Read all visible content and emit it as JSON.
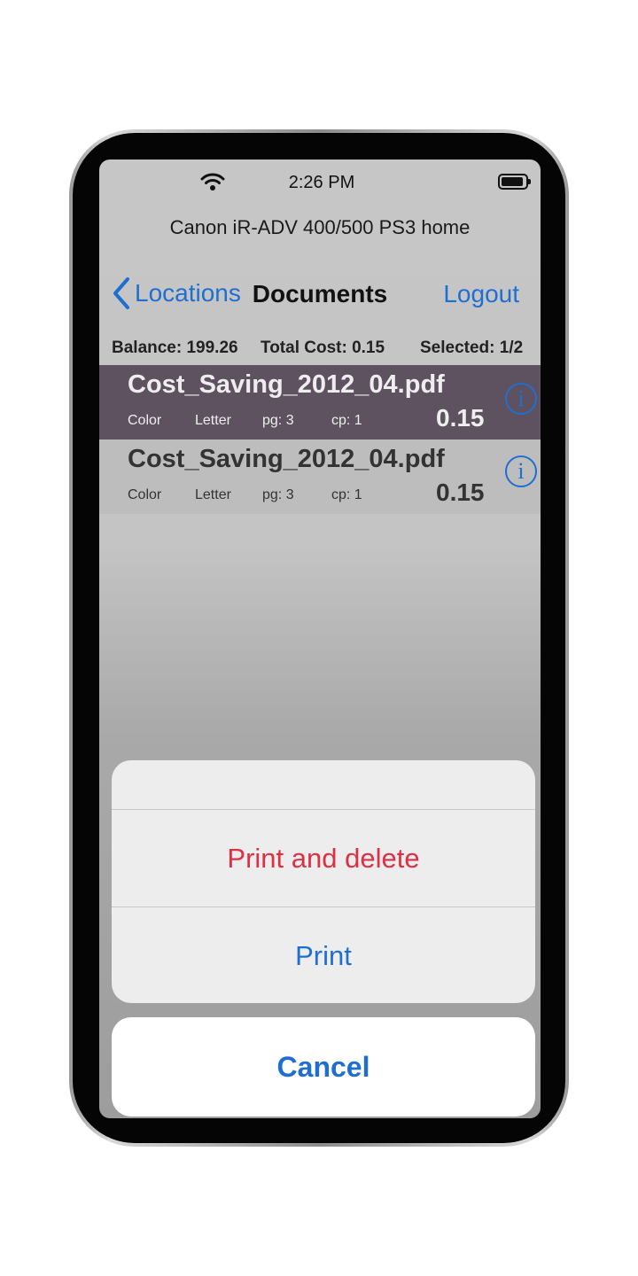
{
  "status_bar": {
    "time": "2:26 PM",
    "wifi_icon": "wifi-icon",
    "battery_icon": "battery-icon"
  },
  "printer_name": "Canon iR-ADV 400/500 PS3 home",
  "nav": {
    "back_label": "Locations",
    "back_icon": "chevron-left-icon",
    "title": "Documents",
    "logout_label": "Logout"
  },
  "summary": {
    "balance": "Balance: 199.26",
    "total_cost": "Total Cost: 0.15",
    "selected": "Selected: 1/2"
  },
  "documents": [
    {
      "name": "Cost_Saving_2012_04.pdf",
      "color": "Color",
      "paper": "Letter",
      "pages": "pg: 3",
      "copies": "cp: 1",
      "cost": "0.15",
      "selected": true
    },
    {
      "name": "Cost_Saving_2012_04.pdf",
      "color": "Color",
      "paper": "Letter",
      "pages": "pg: 3",
      "copies": "cp: 1",
      "cost": "0.15",
      "selected": false
    }
  ],
  "action_sheet": {
    "print_and_delete": "Print and delete",
    "print": "Print",
    "cancel": "Cancel"
  },
  "colors": {
    "accent": "#1f6fd1",
    "destructive": "#dc3045",
    "selected_row": "#5e5260"
  }
}
